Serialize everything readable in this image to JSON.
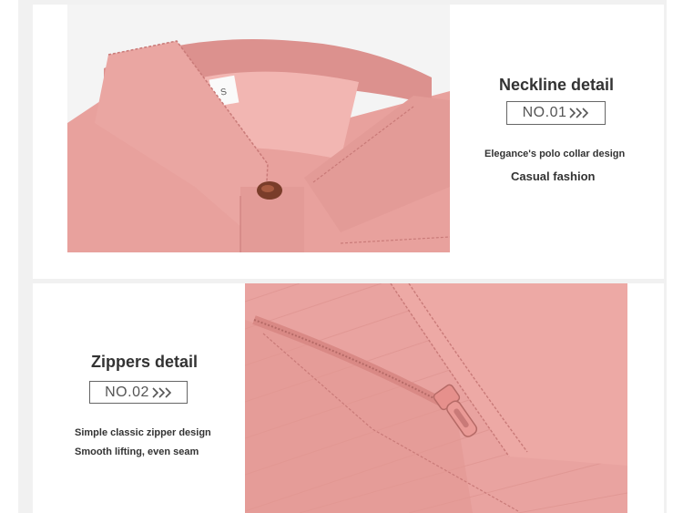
{
  "section1": {
    "title": "Neckline detail",
    "badge": "NO.01",
    "line1": "Elegance's polo collar design",
    "line2": "Casual fashion",
    "size_tag": "S"
  },
  "section2": {
    "title": "Zippers detail",
    "badge": "NO.02",
    "line1": "Simple classic zipper design",
    "line2": "Smooth lifting, even seam"
  },
  "colors": {
    "fabric": "#e9a3a0",
    "fabric_dark": "#c97a78",
    "background": "#f1f1f1"
  },
  "icons": [
    "triple-chevron-right-icon"
  ]
}
